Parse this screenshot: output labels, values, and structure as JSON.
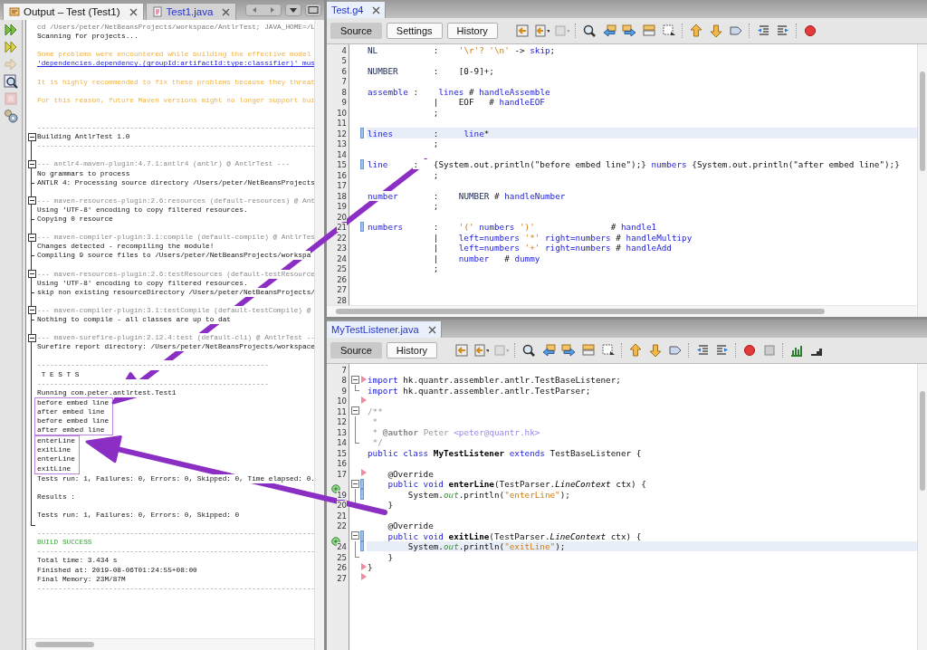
{
  "output_panel": {
    "tabs": [
      {
        "label": "Output – Test (Test1)",
        "selected": true
      },
      {
        "label": "Test1.java",
        "selected": false
      }
    ],
    "lines": [
      {
        "kind": "cmd",
        "text": "cd /Users/peter/NetBeansProjects/workspace/AntlrTest; JAVA_HOME=/L"
      },
      {
        "kind": "text",
        "text": "Scanning for projects..."
      },
      {
        "kind": "blank"
      },
      {
        "kind": "warning",
        "text": "Some problems were encountered while building the effective model"
      },
      {
        "kind": "link",
        "text": "'dependencies.dependency.(groupId:artifactId:type:classifier)' mus"
      },
      {
        "kind": "blank"
      },
      {
        "kind": "warning",
        "text": "It is highly recommended to fix these problems because they threat"
      },
      {
        "kind": "blank"
      },
      {
        "kind": "warning",
        "text": "For this reason, future Maven versions might no longer support bui"
      },
      {
        "kind": "blank"
      },
      {
        "kind": "blank"
      },
      {
        "kind": "rule",
        "text": "------------------------------------------------------------------"
      },
      {
        "kind": "text",
        "fold_start": true,
        "text": "Building AntlrTest 1.0"
      },
      {
        "kind": "rule",
        "text": "------------------------------------------------------------------"
      },
      {
        "kind": "blank"
      },
      {
        "kind": "header",
        "fold_start": true,
        "text": "--- antlr4-maven-plugin:4.7.1:antlr4 (antlr) @ AntlrTest ---"
      },
      {
        "kind": "text",
        "text": "No grammars to process"
      },
      {
        "kind": "text",
        "branch": true,
        "text": "ANTLR 4: Processing source directory /Users/peter/NetBeansProjects"
      },
      {
        "kind": "blank"
      },
      {
        "kind": "header",
        "fold_start": true,
        "text": "--- maven-resources-plugin:2.6:resources (default-resources) @ Ant"
      },
      {
        "kind": "text",
        "text": "Using 'UTF-8' encoding to copy filtered resources."
      },
      {
        "kind": "text",
        "branch": true,
        "text": "Copying 0 resource"
      },
      {
        "kind": "blank"
      },
      {
        "kind": "header",
        "fold_start": true,
        "text": "--- maven-compiler-plugin:3.1:compile (default-compile) @ AntlrTes"
      },
      {
        "kind": "text",
        "text": "Changes detected - recompiling the module!"
      },
      {
        "kind": "text",
        "branch": true,
        "text": "Compiling 9 source files to /Users/peter/NetBeansProjects/workspa"
      },
      {
        "kind": "blank"
      },
      {
        "kind": "header",
        "fold_start": true,
        "text": "--- maven-resources-plugin:2.6:testResources (default-testResource"
      },
      {
        "kind": "text",
        "text": "Using 'UTF-8' encoding to copy filtered resources."
      },
      {
        "kind": "text",
        "branch": true,
        "text": "skip non existing resourceDirectory /Users/peter/NetBeansProjects/"
      },
      {
        "kind": "blank"
      },
      {
        "kind": "header",
        "fold_start": true,
        "text": "--- maven-compiler-plugin:3.1:testCompile (default-testCompile) @"
      },
      {
        "kind": "text",
        "branch": true,
        "text": "Nothing to compile - all classes are up to dat"
      },
      {
        "kind": "blank"
      },
      {
        "kind": "header",
        "fold_start": true,
        "text": "--- maven-surefire-plugin:2.12.4:test (default-cli) @ AntlrTest --"
      },
      {
        "kind": "text",
        "text": "Surefire report directory: /Users/peter/NetBeansProjects/workspace"
      },
      {
        "kind": "blank"
      },
      {
        "kind": "rule",
        "text": "-------------------------------------------------------"
      },
      {
        "kind": "text",
        "text": " T E S T S"
      },
      {
        "kind": "rule",
        "text": "-------------------------------------------------------"
      },
      {
        "kind": "text",
        "text": "Running com.peter.antlrtest.Test1"
      },
      {
        "kind": "box",
        "lines": [
          {
            "text": "before embed line"
          },
          {
            "text": "after embed line"
          },
          {
            "text": "before embed line"
          },
          {
            "text": "after embed line"
          }
        ]
      },
      {
        "kind": "box",
        "lines": [
          {
            "text": "enterLine"
          },
          {
            "text": "exitLine"
          },
          {
            "text": "enterLine"
          },
          {
            "text": "exitLine"
          }
        ]
      },
      {
        "kind": "text",
        "text": "Tests run: 1, Failures: 0, Errors: 0, Skipped: 0, Time elapsed: 0."
      },
      {
        "kind": "blank"
      },
      {
        "kind": "text",
        "text": "Results :"
      },
      {
        "kind": "blank"
      },
      {
        "kind": "text",
        "text": "Tests run: 1, Failures: 0, Errors: 0, Skipped: 0"
      },
      {
        "kind": "blank",
        "tree_end": true
      },
      {
        "kind": "rule",
        "text": "------------------------------------------------------------------"
      },
      {
        "kind": "success",
        "text": "BUILD SUCCESS"
      },
      {
        "kind": "rule",
        "text": "------------------------------------------------------------------"
      },
      {
        "kind": "text",
        "text": "Total time: 3.434 s"
      },
      {
        "kind": "text",
        "text": "Finished at: 2019-08-06T01:24:55+08:00"
      },
      {
        "kind": "text",
        "text": "Final Memory: 23M/87M"
      },
      {
        "kind": "rule",
        "text": "------------------------------------------------------------------"
      }
    ]
  },
  "editors": [
    {
      "tab": {
        "label": "Test.g4",
        "selected": true
      },
      "views": [
        {
          "label": "Source",
          "selected": true
        },
        {
          "label": "Settings",
          "selected": false
        },
        {
          "label": "History",
          "selected": false
        }
      ],
      "lines": [
        {
          "number": "4",
          "current": false,
          "bookmark": false,
          "tokens": [
            {
              "t": "NL",
              "kind": "tok"
            },
            {
              "t": "           :    ",
              "kind": "id"
            },
            {
              "t": "'\\r'? '\\n'",
              "kind": "str"
            },
            {
              "t": " -> ",
              "kind": "id"
            },
            {
              "t": "skip",
              "kind": "rule"
            },
            {
              "t": ";",
              "kind": "id"
            }
          ]
        },
        {
          "number": "5",
          "current": false,
          "bookmark": false
        },
        {
          "number": "6",
          "current": false,
          "bookmark": false,
          "tokens": [
            {
              "t": "NUMBER",
              "kind": "tok"
            },
            {
              "t": "       :    [0-9]+;",
              "kind": "id"
            }
          ]
        },
        {
          "number": "7",
          "current": false,
          "bookmark": false
        },
        {
          "number": "8",
          "current": false,
          "bookmark": false,
          "tokens": [
            {
              "t": "assemble",
              "kind": "rule"
            },
            {
              "t": " :    ",
              "kind": "id"
            },
            {
              "t": "lines",
              "kind": "rule"
            },
            {
              "t": " # ",
              "kind": "id"
            },
            {
              "t": "handleAssemble",
              "kind": "rule"
            }
          ]
        },
        {
          "number": "9",
          "current": false,
          "bookmark": false,
          "tokens": [
            {
              "t": "             |    EOF   # ",
              "kind": "id"
            },
            {
              "t": "handleEOF",
              "kind": "rule"
            }
          ]
        },
        {
          "number": "10",
          "current": false,
          "bookmark": false,
          "tokens": [
            {
              "t": "             ;",
              "kind": "id"
            }
          ]
        },
        {
          "number": "11",
          "current": false,
          "bookmark": false
        },
        {
          "number": "12",
          "current": true,
          "bookmark": true,
          "tokens": [
            {
              "t": "lines",
              "kind": "rule"
            },
            {
              "t": "        :     ",
              "kind": "id"
            },
            {
              "t": "line",
              "kind": "rule"
            },
            {
              "t": "*",
              "kind": "id"
            }
          ]
        },
        {
          "number": "13",
          "current": false,
          "bookmark": false,
          "tokens": [
            {
              "t": "             ;",
              "kind": "id"
            }
          ]
        },
        {
          "number": "14",
          "current": false,
          "bookmark": false
        },
        {
          "number": "15",
          "current": false,
          "bookmark": true,
          "tokens": [
            {
              "t": "line",
              "kind": "rule"
            },
            {
              "t": "     :   {System.out.println(\"before embed line\");} ",
              "kind": "id"
            },
            {
              "t": "numbers",
              "kind": "rule"
            },
            {
              "t": " {System.out.println(\"after embed line\");}",
              "kind": "id"
            }
          ]
        },
        {
          "number": "16",
          "current": false,
          "bookmark": false,
          "tokens": [
            {
              "t": "             ;",
              "kind": "id"
            }
          ]
        },
        {
          "number": "17",
          "current": false,
          "bookmark": false
        },
        {
          "number": "18",
          "current": false,
          "bookmark": false,
          "tokens": [
            {
              "t": "number",
              "kind": "rule"
            },
            {
              "t": "       :    ",
              "kind": "id"
            },
            {
              "t": "NUMBER",
              "kind": "tok"
            },
            {
              "t": " # ",
              "kind": "id"
            },
            {
              "t": "handleNumber",
              "kind": "rule"
            }
          ]
        },
        {
          "number": "19",
          "current": false,
          "bookmark": false,
          "tokens": [
            {
              "t": "             ;",
              "kind": "id"
            }
          ]
        },
        {
          "number": "20",
          "current": false,
          "bookmark": false
        },
        {
          "number": "21",
          "current": false,
          "bookmark": true,
          "tokens": [
            {
              "t": "numbers",
              "kind": "rule"
            },
            {
              "t": "      :    ",
              "kind": "id"
            },
            {
              "t": "'('",
              "kind": "str"
            },
            {
              "t": " numbers ",
              "kind": "rule"
            },
            {
              "t": "')'",
              "kind": "str"
            },
            {
              "t": "               # ",
              "kind": "id"
            },
            {
              "t": "handle1",
              "kind": "rule"
            }
          ]
        },
        {
          "number": "22",
          "current": false,
          "bookmark": false,
          "tokens": [
            {
              "t": "             |    ",
              "kind": "id"
            },
            {
              "t": "left=numbers ",
              "kind": "rule"
            },
            {
              "t": "'*'",
              "kind": "str"
            },
            {
              "t": " right=numbers",
              "kind": "rule"
            },
            {
              "t": " # ",
              "kind": "id"
            },
            {
              "t": "handleMultipy",
              "kind": "rule"
            }
          ]
        },
        {
          "number": "23",
          "current": false,
          "bookmark": false,
          "tokens": [
            {
              "t": "             |    ",
              "kind": "id"
            },
            {
              "t": "left=numbers ",
              "kind": "rule"
            },
            {
              "t": "'+'",
              "kind": "str"
            },
            {
              "t": " right=numbers",
              "kind": "rule"
            },
            {
              "t": " # ",
              "kind": "id"
            },
            {
              "t": "handleAdd",
              "kind": "rule"
            }
          ]
        },
        {
          "number": "24",
          "current": false,
          "bookmark": false,
          "tokens": [
            {
              "t": "             |    ",
              "kind": "id"
            },
            {
              "t": "number",
              "kind": "rule"
            },
            {
              "t": "   # ",
              "kind": "id"
            },
            {
              "t": "dummy",
              "kind": "rule"
            }
          ]
        },
        {
          "number": "25",
          "current": false,
          "bookmark": false,
          "tokens": [
            {
              "t": "             ;",
              "kind": "id"
            }
          ]
        },
        {
          "number": "26",
          "current": false,
          "bookmark": false
        },
        {
          "number": "27",
          "current": false,
          "bookmark": false
        },
        {
          "number": "28",
          "current": false,
          "bookmark": false
        }
      ]
    },
    {
      "tab": {
        "label": "MyTestListener.java",
        "selected": true
      },
      "views": [
        {
          "label": "Source",
          "selected": true
        },
        {
          "label": "History",
          "selected": false
        }
      ],
      "lines": [
        {
          "number": "7",
          "current": false,
          "bookmark": false
        },
        {
          "number": "8",
          "current": false,
          "bookmark": false,
          "fold_start": true,
          "hint": true,
          "tokens": [
            {
              "t": "import",
              "kind": "kw"
            },
            {
              "t": " hk.quantr.assembler.antlr.TestBaseListener;",
              "kind": "id"
            }
          ]
        },
        {
          "number": "9",
          "current": false,
          "bookmark": false,
          "fold_end": true,
          "tokens": [
            {
              "t": "import",
              "kind": "kw"
            },
            {
              "t": " hk.quantr.assembler.antlr.TestParser;",
              "kind": "id"
            }
          ]
        },
        {
          "number": "10",
          "current": false,
          "bookmark": false,
          "hint": true
        },
        {
          "number": "11",
          "current": false,
          "bookmark": false,
          "fold_start": true,
          "tokens": [
            {
              "t": "/**",
              "kind": "com"
            }
          ]
        },
        {
          "number": "12",
          "current": false,
          "bookmark": false,
          "tokens": [
            {
              "t": " *",
              "kind": "com"
            }
          ]
        },
        {
          "number": "13",
          "current": false,
          "bookmark": false,
          "tokens": [
            {
              "t": " * ",
              "kind": "com"
            },
            {
              "t": "@author",
              "kind": "doc"
            },
            {
              "t": " Peter ",
              "kind": "com"
            },
            {
              "t": "<peter@quantr.hk>",
              "kind": "mail"
            }
          ]
        },
        {
          "number": "14",
          "current": false,
          "bookmark": false,
          "fold_end": true,
          "tokens": [
            {
              "t": " */",
              "kind": "com"
            }
          ]
        },
        {
          "number": "15",
          "current": false,
          "bookmark": false,
          "tokens": [
            {
              "t": "public class ",
              "kind": "kw"
            },
            {
              "t": "MyTestListener",
              "kind": "bold"
            },
            {
              "t": " extends ",
              "kind": "kw"
            },
            {
              "t": "TestBaseListener {",
              "kind": "id"
            }
          ]
        },
        {
          "number": "16",
          "current": false,
          "bookmark": false
        },
        {
          "number": "17",
          "current": false,
          "bookmark": false,
          "hint": true,
          "tokens": [
            {
              "t": "    @Override",
              "kind": "id"
            }
          ]
        },
        {
          "current": false,
          "bookmark": true,
          "fold_start": true,
          "override": true,
          "tokens": [
            {
              "t": "    public void ",
              "kind": "kw"
            },
            {
              "t": "enterLine",
              "kind": "bold"
            },
            {
              "t": "(TestParser.",
              "kind": "id"
            },
            {
              "t": "LineContext",
              "kind": "ital"
            },
            {
              "t": " ctx) {",
              "kind": "id"
            }
          ]
        },
        {
          "number": "19",
          "current": false,
          "bookmark": true,
          "tokens": [
            {
              "t": "        System.",
              "kind": "id"
            },
            {
              "t": "out",
              "kind": "field"
            },
            {
              "t": ".println(",
              "kind": "id"
            },
            {
              "t": "\"enterLine\"",
              "kind": "str"
            },
            {
              "t": ");",
              "kind": "id"
            }
          ]
        },
        {
          "number": "20",
          "current": false,
          "bookmark": false,
          "fold_end": true,
          "tokens": [
            {
              "t": "    }",
              "kind": "id"
            }
          ]
        },
        {
          "number": "21",
          "current": false,
          "bookmark": false
        },
        {
          "number": "22",
          "current": false,
          "bookmark": false,
          "tokens": [
            {
              "t": "    @Override",
              "kind": "id"
            }
          ]
        },
        {
          "current": false,
          "bookmark": true,
          "fold_start": true,
          "override": true,
          "tokens": [
            {
              "t": "    public void ",
              "kind": "kw"
            },
            {
              "t": "exitLine",
              "kind": "mark"
            },
            {
              "t": "(TestParser.",
              "kind": "id"
            },
            {
              "t": "LineContext",
              "kind": "ital"
            },
            {
              "t": " ctx) {",
              "kind": "id"
            }
          ]
        },
        {
          "number": "24",
          "current": true,
          "bookmark": true,
          "tokens": [
            {
              "t": "        System.",
              "kind": "id"
            },
            {
              "t": "out",
              "kind": "field"
            },
            {
              "t": ".println(",
              "kind": "id"
            },
            {
              "t": "\"exitLine\"",
              "kind": "str"
            },
            {
              "t": ");",
              "kind": "id"
            }
          ]
        },
        {
          "number": "25",
          "current": false,
          "bookmark": false,
          "fold_end": true,
          "tokens": [
            {
              "t": "    }",
              "kind": "id"
            }
          ]
        },
        {
          "number": "26",
          "current": false,
          "bookmark": false,
          "hint": true,
          "tokens": [
            {
              "t": "}",
              "kind": "id"
            }
          ]
        },
        {
          "number": "27",
          "current": false,
          "bookmark": false,
          "hint": true
        }
      ]
    }
  ]
}
